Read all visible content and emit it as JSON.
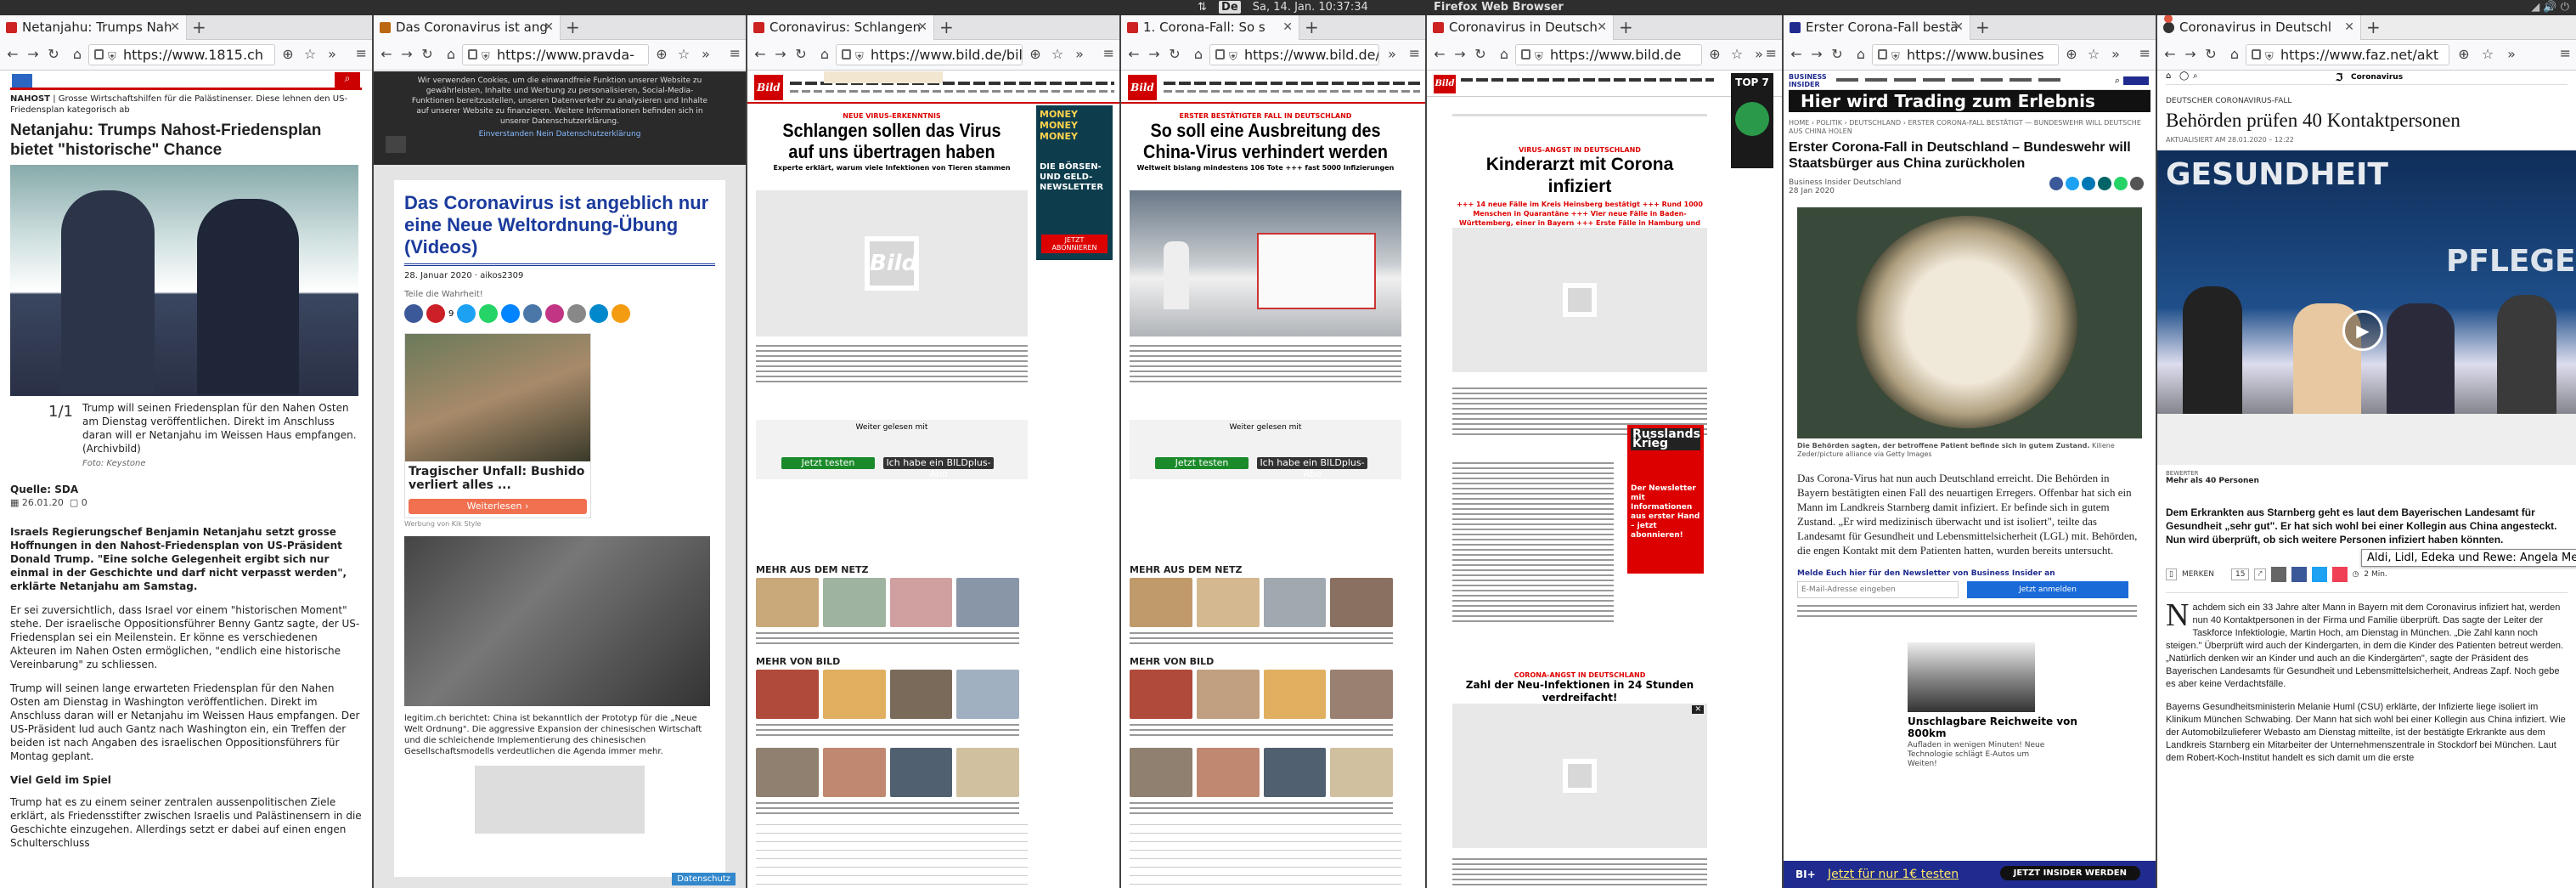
{
  "system_bar": {
    "layout_label": "De",
    "datetime": "Sa, 14. Jan. 10:37:34",
    "app_name": "Firefox Web Browser"
  },
  "windows": [
    {
      "tab": "Netanjahu: Trumps Nah",
      "url": "https://www.1815.ch"
    },
    {
      "tab": "Das Coronavirus ist ang",
      "url": "https://www.pravda-"
    },
    {
      "tab": "Coronavirus: Schlangen",
      "url": "https://www.bild.de/bild"
    },
    {
      "tab": "1. Corona-Fall: So s",
      "url": "https://www.bild.de/bild"
    },
    {
      "tab": "Coronavirus in Deutsch",
      "url": "https://www.bild.de"
    },
    {
      "tab": "Erster Corona-Fall bestä",
      "url": "https://www.busines"
    },
    {
      "tab": "Coronavirus in Deutschl",
      "url": "https://www.faz.net/akt"
    }
  ],
  "w1": {
    "kicker": "NAHOST",
    "kicker_rest": "| Grosse Wirtschaftshilfen für die Palästinenser. Diese lehnen den US-Friedensplan kategorisch ab",
    "headline": "Netanjahu: Trumps Nahost-Friedensplan bietet \"historische\" Chance",
    "counter": "1/1",
    "caption": "Trump will seinen Friedensplan für den Nahen Osten am Dienstag veröffentlichen. Direkt im Anschluss daran will er Netanjahu im Weissen Haus empfangen. (Archivbild)",
    "foto": "Foto: Keystone",
    "source": "Quelle: SDA",
    "date": "26.01.20",
    "comments": "0",
    "lead": "Israels Regierungschef Benjamin Netanjahu setzt grosse Hoffnungen in den Nahost-Friedensplan von US-Präsident Donald Trump. \"Eine solche Gelegenheit ergibt sich nur einmal in der Geschichte und darf nicht verpasst werden\", erklärte Netanjahu am Samstag.",
    "p1": "Er sei zuversichtlich, dass Israel vor einem \"historischen Moment\" stehe. Der israelische Oppositionsführer Benny Gantz sagte, der US-Friedensplan sei ein Meilenstein. Er könne es verschiedenen Akteuren im Nahen Osten ermöglichen, \"endlich eine historische Vereinbarung\" zu schliessen.",
    "p2": "Trump will seinen lange erwarteten Friedensplan für den Nahen Osten am Dienstag in Washington veröffentlichen. Direkt im Anschluss daran will er Netanjahu im Weissen Haus empfangen. Der US-Präsident lud auch Gantz nach Washington ein, ein Treffen der beiden ist nach Angaben des israelischen Oppositionsführers für Montag geplant.",
    "subhead": "Viel Geld im Spiel",
    "p3": "Trump hat es zu einem seiner zentralen aussenpolitischen Ziele erklärt, als Friedensstifter zwischen Israelis und Palästinensern in die Geschichte einzugehen. Allerdings setzt er dabei auf einen engen Schulterschluss"
  },
  "w2": {
    "cookie": "Wir verwenden Cookies, um die einwandfreie Funktion unserer Website zu gewährleisten, Inhalte und Werbung zu personalisieren, Social-Media-Funktionen bereitzustellen, unseren Datenverkehr zu analysieren und Inhalte auf unserer Website zu finanzieren. Weitere Informationen befinden sich in unserer Datenschutzerklärung.",
    "cookie_links": "Einverstanden   Nein   Datenschutzerklärung",
    "headline": "Das Coronavirus ist angeblich nur eine Neue Weltordnung-Übung (Videos)",
    "meta": "28. Januar 2020  ·  aikos2309",
    "share_label": "Teile die Wahrheit!",
    "share_count": "9",
    "ad_title": "Tragischer Unfall: Bushido verliert alles ...",
    "ad_button": "Weiterlesen ›",
    "ad_source": "Werbung von Kik Style",
    "body": "legitim.ch berichtet: China ist bekanntlich der Prototyp für die „Neue Welt Ordnung\". Die aggressive Expansion der chinesischen Wirtschaft und die schleichende Implementierung des chinesischen Gesellschaftsmodells verdeutlichen die Agenda immer mehr.",
    "datenschutz": "Datenschutz"
  },
  "w3": {
    "kicker": "NEUE VIRUS-ERKENNTNIS",
    "headline": "Schlangen sollen das Virus auf uns übertragen haben",
    "sub": "Experte erklärt, warum viele Infektionen von Tieren stammen",
    "ad_title": "DIE BÖRSEN- UND GELD-NEWSLETTER",
    "ad_brand": "MONEY MONEY MONEY",
    "ad_btn": "JETZT ABONNIEREN",
    "gelesen": "Weiter gelesen mit",
    "plus_btn": "Jetzt testen",
    "login_btn": "Ich habe ein BILDplus-Abo",
    "mehr_netz": "MEHR AUS DEM NETZ",
    "mehr_bild": "MEHR VON BILD"
  },
  "w4": {
    "kicker": "ERSTER BESTÄTIGTER FALL IN DEUTSCHLAND",
    "headline": "So soll eine Ausbreitung des China-Virus verhindert werden",
    "sub": "Weltweit bislang mindestens 106 Tote +++ fast 5000 Infizierungen",
    "mehr_netz": "MEHR AUS DEM NETZ",
    "mehr_bild": "MEHR VON BILD"
  },
  "w5": {
    "kicker": "VIRUS-ANGST IN DEUTSCHLAND",
    "headline": "Kinderarzt mit Corona infiziert",
    "sub": "+++ 14 neue Fälle im Kreis Heinsberg bestätigt +++ Rund 1000 Menschen in Quarantäne +++ Vier neue Fälle in Baden-Württemberg, einer in Bayern +++ Erste Fälle in Hamburg und Hessen",
    "badge": "TOP 7",
    "ad_red": "Russlands Krieg",
    "ad_news": "Der Newsletter mit Informationen aus erster Hand – jetzt abonnieren!",
    "ticker_title": "Zahl der Neu-Infektionen in 24 Stunden verdreifacht!",
    "ticker_kicker": "CORONA-ANGST IN DEUTSCHLAND"
  },
  "w6": {
    "logo_top": "BUSINESS",
    "logo_bottom": "INSIDER",
    "banner": "Hier wird Trading zum Erlebnis",
    "breadcrumb": "HOME › POLITIK › DEUTSCHLAND › ERSTER CORONA-FALL BESTÄTIGT — BUNDESWEHR WILL DEUTSCHE AUS CHINA HOLEN",
    "headline": "Erster Corona-Fall in Deutschland – Bundeswehr will Staatsbürger aus China zurückholen",
    "author": "Business Insider Deutschland",
    "date": "28 Jan 2020",
    "caption": "Die Behörden sagten, der betroffene Patient befinde sich in gutem Zustand.",
    "credit": "Kiliene Zeder/picture alliance via Getty Images",
    "body": "Das Corona-Virus hat nun auch Deutschland erreicht. Die Behörden in Bayern bestätigten einen Fall des neuartigen Erregers. Offenbar hat sich ein Mann im Landkreis Starnberg damit infiziert. Er befinde sich in gutem Zustand. „Er wird medizinisch überwacht und ist isoliert\", teilte das Landesamt für Gesundheit und Lebensmittelsicherheit (LGL) mit. Behörden, die engen Kontakt mit dem Patienten hatten, wurden bereits untersucht.",
    "newsletter": "Melde Euch hier für den Newsletter von Business Insider an",
    "email_ph": "E-Mail-Adresse eingeben",
    "subscribe": "Jetzt anmelden",
    "ad_title": "Unschlagbare Reichweite von 800km",
    "ad_text": "Aufladen in wenigen Minuten! Neue Technologie schlägt E-Autos um Weiten!",
    "footer_test": "Jetzt für nur 1€ testen",
    "footer_btn": "JETZT INSIDER WERDEN",
    "footer_logo": "BI+"
  },
  "w7": {
    "brand": "Coronavirus",
    "kicker": "DEUTSCHER CORONAVIRUS-FALL",
    "headline": "Behörden prüfen 40 Kontaktpersonen",
    "updated": "AKTUALISIERT AM 28.01.2020  –  12:22",
    "video_text": "GESUNDHEIT",
    "video_text2": "PFLEGE",
    "caption_k": "BEWERTER",
    "caption": "Mehr als 40 Personen",
    "tooltip": "Aldi, Lidl, Edeka und Rewe: Angela Merkel",
    "lead": "Dem Erkrankten aus Starnberg geht es laut dem Bayerischen Landesamt für Gesundheit „sehr gut\". Er hat sich wohl bei einer Kollegin aus China angesteckt. Nun wird überprüft, ob sich weitere Personen infiziert haben könnten.",
    "merken": "MERKEN",
    "count": "15",
    "read": "2 Min.",
    "body1": "achdem sich ein 33 Jahre alter Mann in Bayern mit dem Coronavirus infiziert hat, werden nun 40 Kontaktpersonen in der Firma und Familie überprüft. Das sagte der Leiter der Taskforce Infektiologie, Martin Hoch, am Dienstag in München. „Die Zahl kann noch steigen.\" Überprüft wird auch der Kindergarten, in dem die Kinder des Patienten betreut werden. „Natürlich denken wir an Kinder und auch an die Kindergärten\", sagte der Präsident des Bayerischen Landesamts für Gesundheit und Lebensmittelsicherheit, Andreas Zapf. Noch gebe es aber keine Verdachtsfälle.",
    "dropcap": "N",
    "body2": "Bayerns Gesundheitsministerin Melanie Huml (CSU) erklärte, der Infizierte liege isoliert im Klinikum München Schwabing. Der Mann hat sich wohl bei einer Kollegin aus China infiziert. Wie der Automobilzulieferer Webasto am Dienstag mitteilte, ist der bestätigte Erkrankte aus dem Landkreis Starnberg ein Mitarbeiter der Unternehmenszentrale in Stockdorf bei München. Laut dem Robert-Koch-Institut handelt es sich damit um die erste"
  },
  "colors": {
    "bild_red": "#d00000",
    "bi_blue": "#1f2b8f",
    "faz_blue": "#0a4b8c",
    "pravda_blue": "#1a3a9c"
  }
}
